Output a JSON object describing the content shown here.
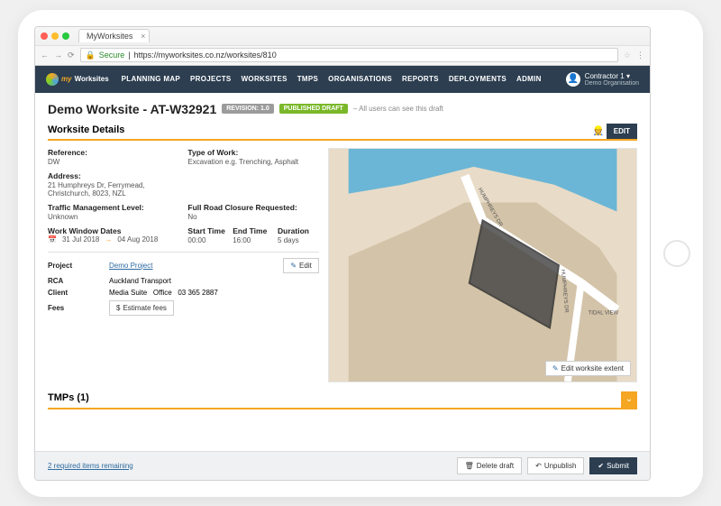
{
  "browser": {
    "tab_title": "MyWorksites",
    "secure_label": "Secure",
    "url": "https://myworksites.co.nz/worksites/810"
  },
  "header": {
    "logo_my": "my",
    "logo_ws": "Worksites",
    "nav": [
      "PLANNING MAP",
      "PROJECTS",
      "WORKSITES",
      "TMPS",
      "ORGANISATIONS",
      "REPORTS",
      "DEPLOYMENTS",
      "ADMIN"
    ],
    "user_name": "Contractor 1",
    "user_org": "Demo Organisation"
  },
  "page": {
    "title": "Demo Worksite - AT-W32921",
    "badge_revision": "REVISION: 1.0",
    "badge_status": "PUBLISHED DRAFT",
    "draft_note": "– All users can see this draft"
  },
  "details": {
    "section_title": "Worksite Details",
    "edit_label": "EDIT",
    "reference_label": "Reference:",
    "reference_value": "DW",
    "type_label": "Type of Work:",
    "type_value": "Excavation e.g. Trenching, Asphalt",
    "address_label": "Address:",
    "address_value": "21 Humphreys Dr, Ferrymead, Christchurch, 8023, NZL",
    "tml_label": "Traffic Management Level:",
    "tml_value": "Unknown",
    "closure_label": "Full Road Closure Requested:",
    "closure_value": "No",
    "window_label": "Work Window Dates",
    "window_start": "31 Jul 2018",
    "window_end": "04 Aug 2018",
    "start_time_label": "Start Time",
    "start_time_value": "00:00",
    "end_time_label": "End Time",
    "end_time_value": "16:00",
    "duration_label": "Duration",
    "duration_value": "5 days"
  },
  "project": {
    "project_label": "Project",
    "project_link": "Demo Project",
    "edit_label": "Edit",
    "rca_label": "RCA",
    "rca_value": "Auckland Transport",
    "client_label": "Client",
    "client_value": "Media Suite",
    "client_office_label": "Office",
    "client_phone": "03 365 2887",
    "fees_label": "Fees",
    "estimate_label": "Estimate fees"
  },
  "map": {
    "edit_extent_label": "Edit worksite extent",
    "street_label_1": "HUMPHREYS DR",
    "street_label_2": "HUMPHREYS DR",
    "street_label_3": "TIDAL VIEW"
  },
  "tmps": {
    "title": "TMPs (1)"
  },
  "footer": {
    "required_text": "2 required items remaining",
    "delete_label": "Delete draft",
    "unpublish_label": "Unpublish",
    "submit_label": "Submit"
  }
}
